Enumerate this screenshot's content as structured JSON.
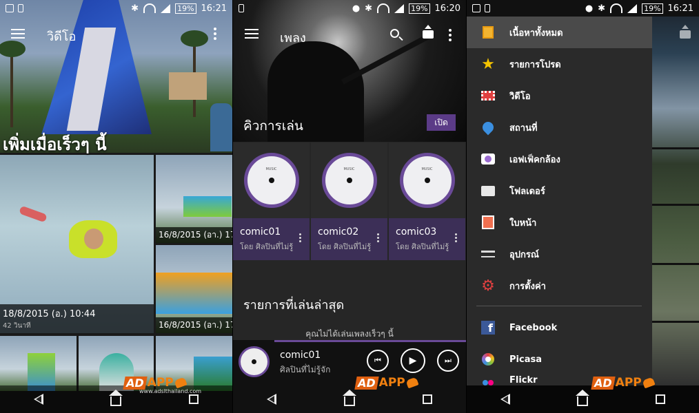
{
  "status": {
    "p1_time": "16:21",
    "p2_time": "16:20",
    "p3_time": "16:21",
    "battery": "19%"
  },
  "video": {
    "title": "วิดีโอ",
    "section": "เพิ่มเมื่อเร็วๆ นี้",
    "items": [
      {
        "date": "18/8/2015 (อ.) 10:44",
        "duration": "42 วินาที"
      },
      {
        "date": "16/8/2015 (อา.) 17"
      },
      {
        "date": "16/8/2015 (อา.) 17"
      }
    ]
  },
  "music": {
    "title": "เพลง",
    "queue_label": "คิวการเล่น",
    "open_label": "เปิด",
    "disc_label": "MUSIC",
    "albums": [
      {
        "name": "comic01",
        "artist": "โดย ศิลปินที่ไม่รู้"
      },
      {
        "name": "comic02",
        "artist": "โดย ศิลปินที่ไม่รู้"
      },
      {
        "name": "comic03",
        "artist": "โดย ศิลปินที่ไม่รู้"
      }
    ],
    "recent_label": "รายการที่เล่นล่าสุด",
    "recent_empty": "คุณไม่ได้เล่นเพลงเร็วๆ นี้",
    "player": {
      "title": "comic01",
      "artist": "ศิลปินที่ไม่รู้จัก"
    }
  },
  "drawer": {
    "items": [
      {
        "label": "เนื้อหาทั้งหมด",
        "icon": "grid-icon",
        "color": "#f2b431"
      },
      {
        "label": "รายการโปรด",
        "icon": "star-icon",
        "color": "#f5c400"
      },
      {
        "label": "วิดีโอ",
        "icon": "film-icon",
        "color": "#e04040"
      },
      {
        "label": "สถานที่",
        "icon": "location-pin-icon",
        "color": "#3b8fe0"
      },
      {
        "label": "เอฟเฟ็คกล้อง",
        "icon": "camera-icon",
        "color": "#9b6bd0"
      },
      {
        "label": "โฟลเดอร์",
        "icon": "folder-icon",
        "color": "#e8e8e8"
      },
      {
        "label": "ใบหน้า",
        "icon": "face-icon",
        "color": "#f07050"
      },
      {
        "label": "อุปกรณ์",
        "icon": "device-icon",
        "color": "#dddddd"
      },
      {
        "label": "การตั้งค่า",
        "icon": "gear-icon",
        "color": "#e04040"
      }
    ],
    "services": [
      {
        "label": "Facebook",
        "icon": "facebook-icon",
        "color": "#3b5998"
      },
      {
        "label": "Picasa",
        "icon": "picasa-icon",
        "color": "#7fbf3f"
      },
      {
        "label": "Flickr",
        "icon": "flickr-icon",
        "color": "#ff0084"
      }
    ]
  },
  "watermark": {
    "brand": "APP",
    "prefix": "AD",
    "domain": "www.adslthailand.com"
  }
}
